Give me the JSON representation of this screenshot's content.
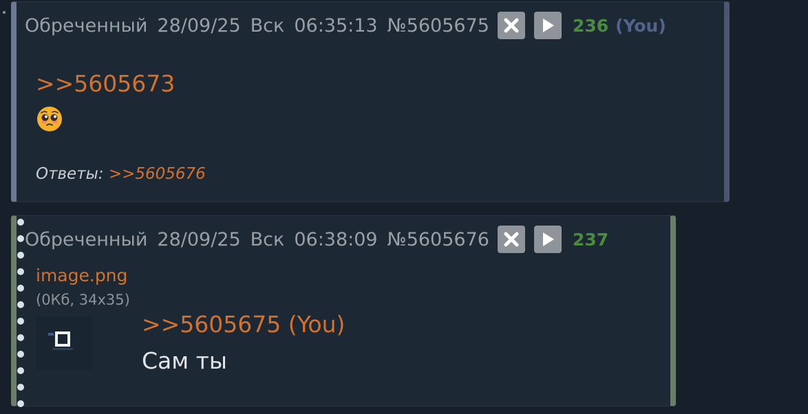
{
  "posts": [
    {
      "author": "Обреченный",
      "date": "28/09/25",
      "weekday": "Вск",
      "time": "06:35:13",
      "number": "№5605675",
      "index": "236",
      "you": "(You)",
      "reply_to": ">>5605673",
      "emoji": "pleading-face",
      "replies_label": "Ответы:",
      "replies": [
        ">>5605676"
      ]
    },
    {
      "author": "Обреченный",
      "date": "28/09/25",
      "weekday": "Вск",
      "time": "06:38:09",
      "number": "№5605676",
      "index": "237",
      "file": {
        "name": "image.png",
        "meta": "(0Кб, 34x35)"
      },
      "reply_to": ">>5605675 (You)",
      "message": "Сам ты"
    }
  ],
  "colors": {
    "background": "#161f2a",
    "post_bg": "#1d2835",
    "link": "#d2722e",
    "post_index": "#4c8b3f",
    "you_mark": "#52648a",
    "header_text": "#9a9fa6",
    "button_bg": "#8e949a"
  },
  "icons": {
    "hide": "close-icon",
    "expand": "play-icon"
  }
}
